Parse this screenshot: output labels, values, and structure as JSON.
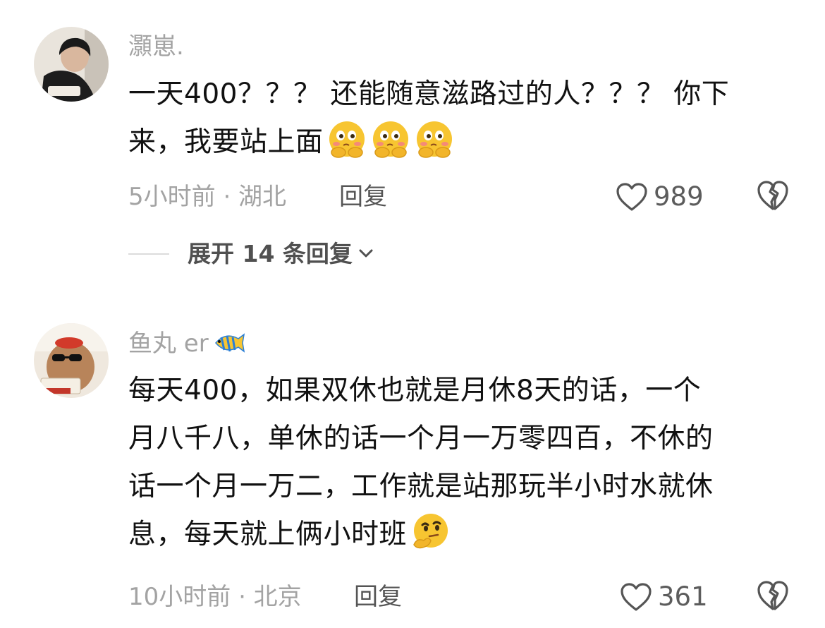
{
  "comments": [
    {
      "username": "灝崽.",
      "text_line1": "一天400？？？ 还能随意滋路过的人？？？ 你下",
      "text_line2": "来，我要站上面",
      "time_location": "5小时前 · 湖北",
      "reply_label": "回复",
      "likes": "989",
      "expand_label": "展开 14 条回复",
      "emoji": "shy-pondering-face",
      "emoji_count": 3
    },
    {
      "username": "鱼丸 er",
      "username_emoji": "tropical-fish",
      "text_line1": "每天400，如果双休也就是月休8天的话，一个",
      "text_line2": "月八千八，单休的话一个月一万零四百，不休的",
      "text_line3": "话一个月一万二，工作就是站那玩半小时水就休",
      "text_line4": "息，每天就上俩小时班",
      "time_location": "10小时前 · 北京",
      "reply_label": "回复",
      "likes": "361",
      "emoji": "thinking-face",
      "emoji_count": 1
    }
  ],
  "colors": {
    "meta_gray": "#a3a3a3",
    "body_black": "#111111",
    "emoji_yellow": "#f7c531"
  },
  "icons": {
    "like": "heart-outline-icon",
    "dislike": "broken-heart-outline-icon",
    "expand": "chevron-down-icon"
  }
}
